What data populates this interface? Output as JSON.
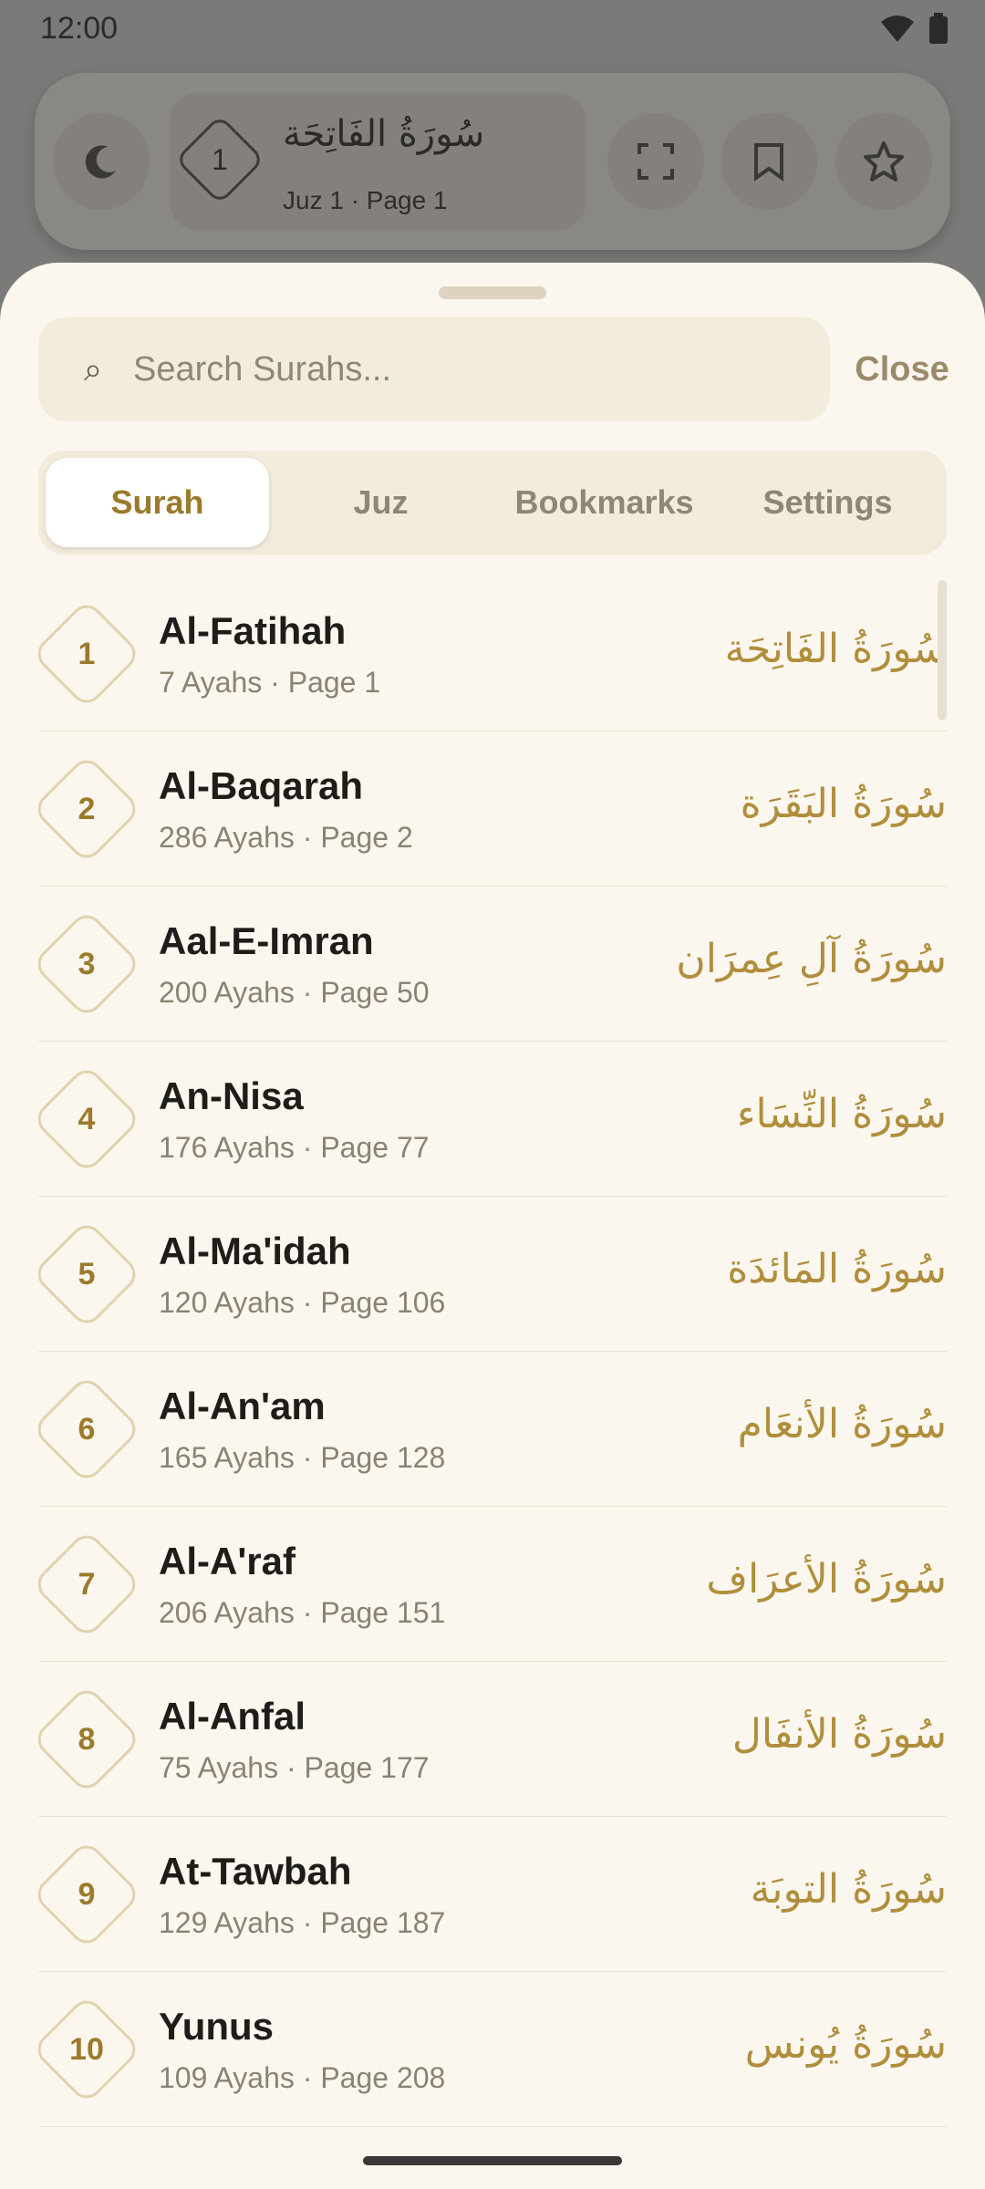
{
  "status_bar": {
    "time": "12:00"
  },
  "top_bar": {
    "surah_number": "1",
    "surah_arabic": "سُورَةُ الفَاتِحَة",
    "location": "Juz 1 · Page 1"
  },
  "search": {
    "placeholder": "Search Surahs...",
    "value": ""
  },
  "close_label": "Close",
  "tabs": [
    {
      "label": "Surah",
      "active": true
    },
    {
      "label": "Juz",
      "active": false
    },
    {
      "label": "Bookmarks",
      "active": false
    },
    {
      "label": "Settings",
      "active": false
    }
  ],
  "surahs": [
    {
      "number": "1",
      "name": "Al-Fatihah",
      "meta": "7 Ayahs · Page 1",
      "arabic": "سُورَةُ الفَاتِحَة"
    },
    {
      "number": "2",
      "name": "Al-Baqarah",
      "meta": "286 Ayahs · Page 2",
      "arabic": "سُورَةُ البَقَرَة"
    },
    {
      "number": "3",
      "name": "Aal-E-Imran",
      "meta": "200 Ayahs · Page 50",
      "arabic": "سُورَةُ آلِ عِمرَان"
    },
    {
      "number": "4",
      "name": "An-Nisa",
      "meta": "176 Ayahs · Page 77",
      "arabic": "سُورَةُ النِّسَاء"
    },
    {
      "number": "5",
      "name": "Al-Ma'idah",
      "meta": "120 Ayahs · Page 106",
      "arabic": "سُورَةُ المَائدَة"
    },
    {
      "number": "6",
      "name": "Al-An'am",
      "meta": "165 Ayahs · Page 128",
      "arabic": "سُورَةُ الأنعَام"
    },
    {
      "number": "7",
      "name": "Al-A'raf",
      "meta": "206 Ayahs · Page 151",
      "arabic": "سُورَةُ الأعرَاف"
    },
    {
      "number": "8",
      "name": "Al-Anfal",
      "meta": "75 Ayahs · Page 177",
      "arabic": "سُورَةُ الأنفَال"
    },
    {
      "number": "9",
      "name": "At-Tawbah",
      "meta": "129 Ayahs · Page 187",
      "arabic": "سُورَةُ التوبَة"
    },
    {
      "number": "10",
      "name": "Yunus",
      "meta": "109 Ayahs · Page 208",
      "arabic": "سُورَةُ يُونس"
    }
  ]
}
